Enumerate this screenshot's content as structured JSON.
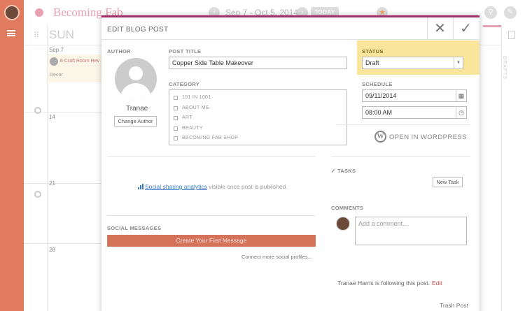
{
  "app": {
    "title": "Becoming Fab",
    "date_range": "Sep 7 - Oct 5, 2014",
    "today_label": "TODAY",
    "prev_icon": "chevron-left-icon",
    "next_icon": "chevron-right-icon",
    "star_icon": "star-icon",
    "search_icon": "search-icon",
    "edit_icon": "pencil-icon",
    "menu_icon": "hamburger-icon"
  },
  "calendar": {
    "weekday": "SUN",
    "days": [
      "Sep 7",
      "14",
      "21",
      "28"
    ],
    "post_preview": {
      "count": "8",
      "title": "Craft Room Rev",
      "category": "Decor"
    },
    "drafts_label": "DRAFTS"
  },
  "modal": {
    "title": "EDIT BLOG POST",
    "author": {
      "label": "AUTHOR",
      "name": "Tranae",
      "change_button": "Change Author"
    },
    "post_title": {
      "label": "POST TITLE",
      "value": "Copper Side Table Makeover"
    },
    "category": {
      "label": "CATEGORY",
      "items": [
        "101 IN 1001",
        "ABOUT ME",
        "ART",
        "BEAUTY",
        "BECOMING FAB SHOP"
      ]
    },
    "status": {
      "label": "STATUS",
      "value": "Draft"
    },
    "schedule": {
      "label": "SCHEDULE",
      "date": "09/11/2014",
      "time": "08:00 AM"
    },
    "wordpress_link": "OPEN IN WORDPRESS",
    "analytics": {
      "link": "Social sharing analytics",
      "suffix": " visible once post is published."
    },
    "tasks": {
      "label": "TASKS",
      "new_button": "New Task"
    },
    "comments": {
      "label": "COMMENTS",
      "placeholder": "Add a comment..."
    },
    "social": {
      "label": "SOCIAL MESSAGES",
      "create_button": "Create Your First Message",
      "connect_link": "Connect more social profiles..."
    },
    "following": {
      "text": "Tranae Harris is following this post.",
      "edit": "Edit"
    },
    "trash": "Trash Post"
  },
  "colors": {
    "rail": "#e27a5f",
    "modal_accent": "#a32f6a",
    "status_highlight": "#fae69a",
    "create_button": "#d4735a",
    "link_blue": "#3c7ac7",
    "title_pink": "#e8a1b1"
  }
}
